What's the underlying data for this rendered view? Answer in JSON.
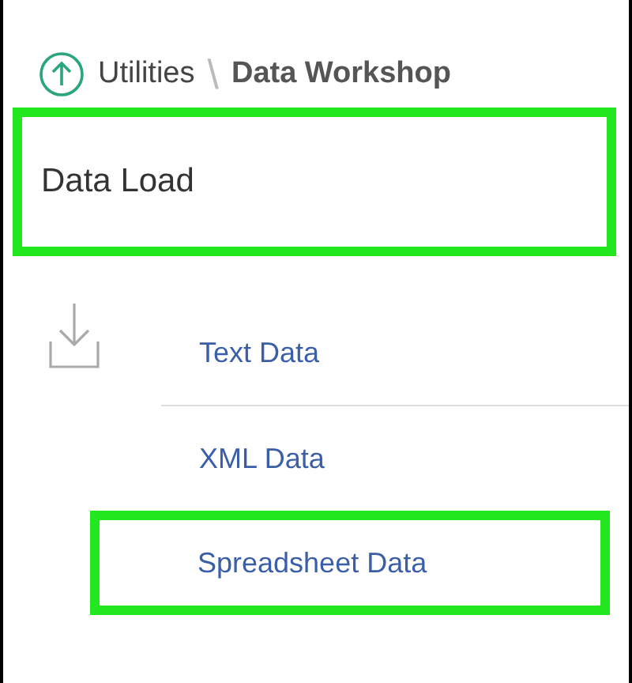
{
  "breadcrumb": {
    "items": [
      {
        "label": "Utilities",
        "current": false
      },
      {
        "label": "Data Workshop",
        "current": true
      }
    ],
    "separator": "\\"
  },
  "section": {
    "title": "Data Load",
    "highlighted": true
  },
  "items": [
    {
      "label": "Text Data",
      "highlighted": false
    },
    {
      "label": "XML Data",
      "highlighted": false
    },
    {
      "label": "Spreadsheet Data",
      "highlighted": true
    }
  ]
}
